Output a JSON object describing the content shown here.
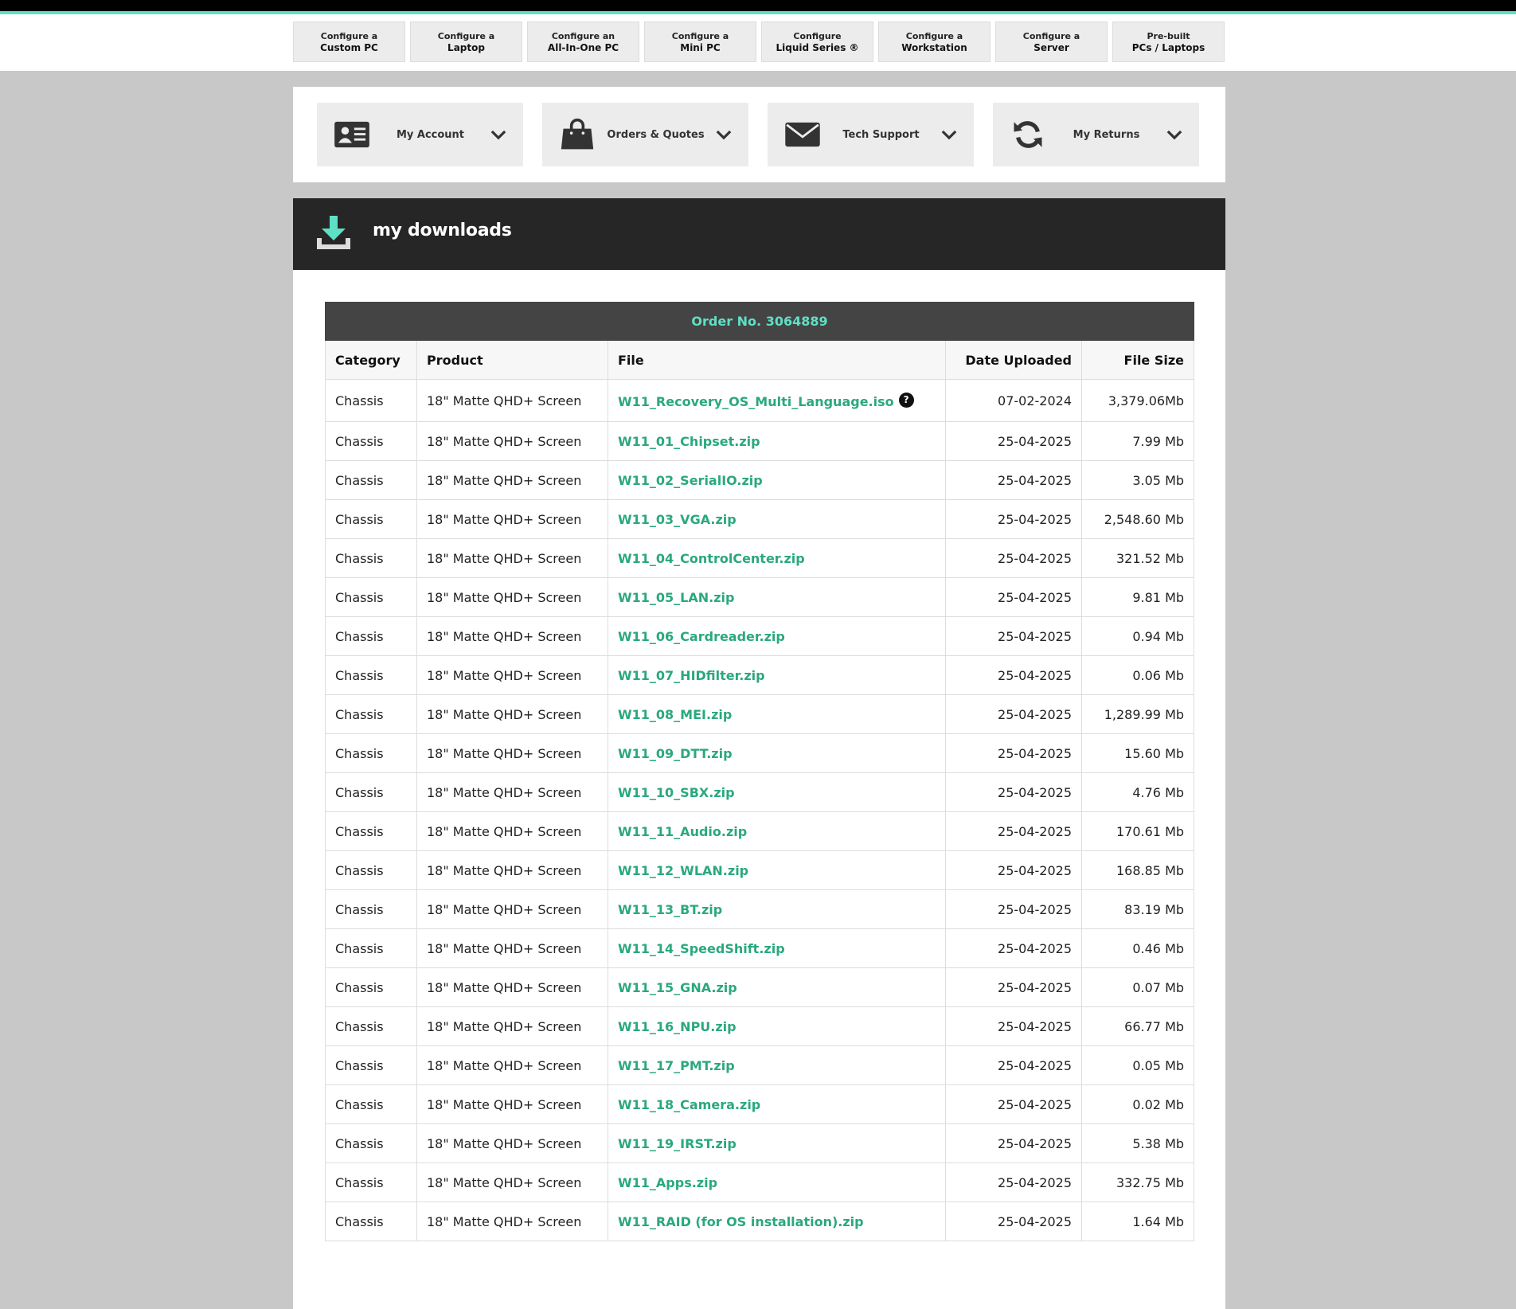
{
  "nav": {
    "items": [
      {
        "line1": "Configure a",
        "line2": "Custom PC"
      },
      {
        "line1": "Configure a",
        "line2": "Laptop"
      },
      {
        "line1": "Configure an",
        "line2": "All-In-One PC"
      },
      {
        "line1": "Configure a",
        "line2": "Mini PC"
      },
      {
        "line1": "Configure",
        "line2": "Liquid Series ®"
      },
      {
        "line1": "Configure a",
        "line2": "Workstation"
      },
      {
        "line1": "Configure a",
        "line2": "Server"
      },
      {
        "line1": "Pre-built",
        "line2": "PCs / Laptops"
      }
    ]
  },
  "account": {
    "tiles": [
      {
        "label": "My Account",
        "icon": "id-card-icon"
      },
      {
        "label": "Orders & Quotes",
        "icon": "shopping-bag-icon"
      },
      {
        "label": "Tech Support",
        "icon": "envelope-icon"
      },
      {
        "label": "My Returns",
        "icon": "refresh-icon"
      }
    ]
  },
  "downloads": {
    "title": "my downloads",
    "icon": "download-icon"
  },
  "order": {
    "title": "Order No. 3064889",
    "headers": [
      "Category",
      "Product",
      "File",
      "Date Uploaded",
      "File Size"
    ],
    "help_badge": "?",
    "rows": [
      {
        "category": "Chassis",
        "product": "18\" Matte QHD+ Screen",
        "file": "W11_Recovery_OS_Multi_Language.iso",
        "date": "07-02-2024",
        "size": "3,379.06Mb"
      },
      {
        "category": "Chassis",
        "product": "18\" Matte QHD+ Screen",
        "file": "W11_01_Chipset.zip",
        "date": "25-04-2025",
        "size": "7.99 Mb"
      },
      {
        "category": "Chassis",
        "product": "18\" Matte QHD+ Screen",
        "file": "W11_02_SerialIO.zip",
        "date": "25-04-2025",
        "size": "3.05 Mb"
      },
      {
        "category": "Chassis",
        "product": "18\" Matte QHD+ Screen",
        "file": "W11_03_VGA.zip",
        "date": "25-04-2025",
        "size": "2,548.60 Mb"
      },
      {
        "category": "Chassis",
        "product": "18\" Matte QHD+ Screen",
        "file": "W11_04_ControlCenter.zip",
        "date": "25-04-2025",
        "size": "321.52 Mb"
      },
      {
        "category": "Chassis",
        "product": "18\" Matte QHD+ Screen",
        "file": "W11_05_LAN.zip",
        "date": "25-04-2025",
        "size": "9.81 Mb"
      },
      {
        "category": "Chassis",
        "product": "18\" Matte QHD+ Screen",
        "file": "W11_06_Cardreader.zip",
        "date": "25-04-2025",
        "size": "0.94 Mb"
      },
      {
        "category": "Chassis",
        "product": "18\" Matte QHD+ Screen",
        "file": "W11_07_HIDfilter.zip",
        "date": "25-04-2025",
        "size": "0.06 Mb"
      },
      {
        "category": "Chassis",
        "product": "18\" Matte QHD+ Screen",
        "file": "W11_08_MEI.zip",
        "date": "25-04-2025",
        "size": "1,289.99 Mb"
      },
      {
        "category": "Chassis",
        "product": "18\" Matte QHD+ Screen",
        "file": "W11_09_DTT.zip",
        "date": "25-04-2025",
        "size": "15.60 Mb"
      },
      {
        "category": "Chassis",
        "product": "18\" Matte QHD+ Screen",
        "file": "W11_10_SBX.zip",
        "date": "25-04-2025",
        "size": "4.76 Mb"
      },
      {
        "category": "Chassis",
        "product": "18\" Matte QHD+ Screen",
        "file": "W11_11_Audio.zip",
        "date": "25-04-2025",
        "size": "170.61 Mb"
      },
      {
        "category": "Chassis",
        "product": "18\" Matte QHD+ Screen",
        "file": "W11_12_WLAN.zip",
        "date": "25-04-2025",
        "size": "168.85 Mb"
      },
      {
        "category": "Chassis",
        "product": "18\" Matte QHD+ Screen",
        "file": "W11_13_BT.zip",
        "date": "25-04-2025",
        "size": "83.19 Mb"
      },
      {
        "category": "Chassis",
        "product": "18\" Matte QHD+ Screen",
        "file": "W11_14_SpeedShift.zip",
        "date": "25-04-2025",
        "size": "0.46 Mb"
      },
      {
        "category": "Chassis",
        "product": "18\" Matte QHD+ Screen",
        "file": "W11_15_GNA.zip",
        "date": "25-04-2025",
        "size": "0.07 Mb"
      },
      {
        "category": "Chassis",
        "product": "18\" Matte QHD+ Screen",
        "file": "W11_16_NPU.zip",
        "date": "25-04-2025",
        "size": "66.77 Mb"
      },
      {
        "category": "Chassis",
        "product": "18\" Matte QHD+ Screen",
        "file": "W11_17_PMT.zip",
        "date": "25-04-2025",
        "size": "0.05 Mb"
      },
      {
        "category": "Chassis",
        "product": "18\" Matte QHD+ Screen",
        "file": "W11_18_Camera.zip",
        "date": "25-04-2025",
        "size": "0.02 Mb"
      },
      {
        "category": "Chassis",
        "product": "18\" Matte QHD+ Screen",
        "file": "W11_19_IRST.zip",
        "date": "25-04-2025",
        "size": "5.38 Mb"
      },
      {
        "category": "Chassis",
        "product": "18\" Matte QHD+ Screen",
        "file": "W11_Apps.zip",
        "date": "25-04-2025",
        "size": "332.75 Mb"
      },
      {
        "category": "Chassis",
        "product": "18\" Matte QHD+ Screen",
        "file": "W11_RAID (for OS installation).zip",
        "date": "25-04-2025",
        "size": "1.64 Mb"
      }
    ]
  },
  "colors": {
    "accent": "#5fe0c4",
    "link": "#2aa87f",
    "header_dark": "#262626",
    "page_bg": "#c8c8c8"
  }
}
